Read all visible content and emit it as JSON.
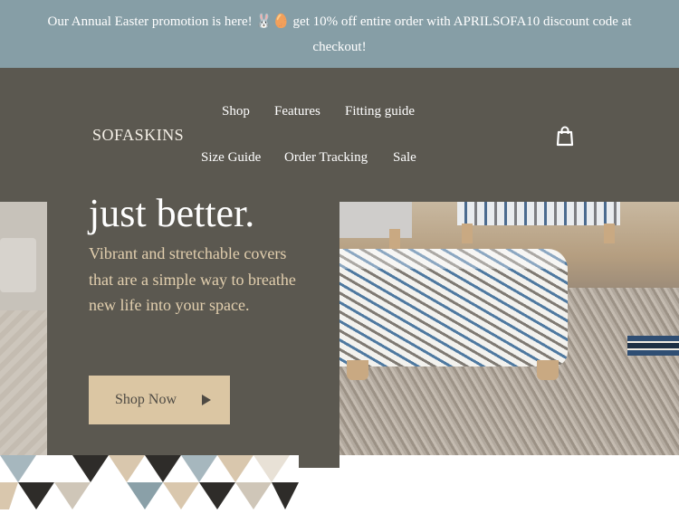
{
  "announcement": {
    "text": "Our Annual Easter promotion is here! 🐰🥚 get 10% off entire order with APRILSOFA10 discount code at checkout!"
  },
  "header": {
    "logo": "SOFASKINS",
    "nav": [
      {
        "label": "Shop"
      },
      {
        "label": "Features"
      },
      {
        "label": "Fitting guide"
      },
      {
        "label": "Size Guide"
      },
      {
        "label": "Order Tracking"
      },
      {
        "label": "Sale"
      }
    ],
    "cart_icon": "shopping-bag-icon"
  },
  "hero": {
    "headline": "just better.",
    "subtext": "Vibrant and stretchable covers that are a simple way to breathe new life into your space.",
    "cta_label": "Shop Now",
    "cta_icon": "play-arrow-icon"
  },
  "colors": {
    "announcement_bg": "#869ea6",
    "header_bg": "#5b5850",
    "accent_text": "#e2cfae",
    "cta_bg": "#dbc6a3"
  }
}
